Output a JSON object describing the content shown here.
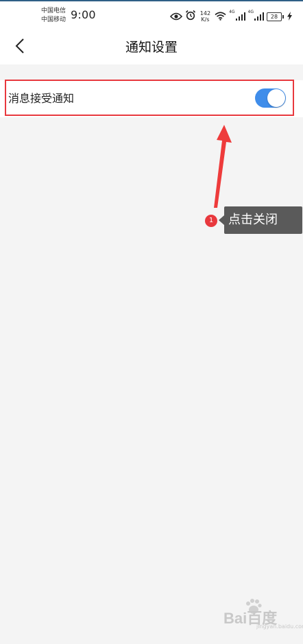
{
  "status_bar": {
    "carrier_1": "中国电信",
    "carrier_2": "中国移动",
    "time": "9:00",
    "speed_value": "142",
    "speed_unit": "K/s",
    "signal_1_tag": "4G",
    "signal_2_tag": "4G",
    "battery_level": "28"
  },
  "nav": {
    "title": "通知设置",
    "back_icon": "chevron-left-icon"
  },
  "settings": {
    "message_notification": {
      "label": "消息接受通知",
      "enabled": true
    }
  },
  "annotation": {
    "step_number": "1",
    "callout_text": "点击关闭",
    "highlight_color": "#e8383d"
  },
  "watermark": {
    "text": "Bai百度",
    "sub": "jingyan.baidu.com"
  },
  "colors": {
    "toggle_on": "#3f8dea",
    "page_bg": "#f4f4f4",
    "annotation_red": "#e8383d",
    "callout_bg": "#5a5a5a"
  }
}
